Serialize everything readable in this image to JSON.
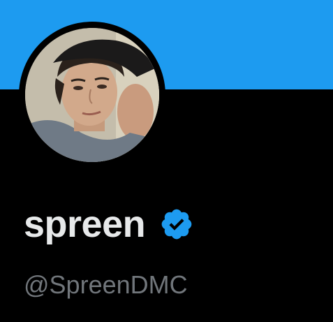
{
  "profile": {
    "display_name": "spreen",
    "handle": "@SpreenDMC",
    "verified": true
  },
  "colors": {
    "banner": "#1d9bf0",
    "background": "#000000",
    "name_text": "#e7e9ea",
    "handle_text": "#71767b",
    "verified_badge": "#1d9bf0"
  },
  "icons": {
    "verified": "verified-badge-icon",
    "avatar": "profile-avatar"
  }
}
